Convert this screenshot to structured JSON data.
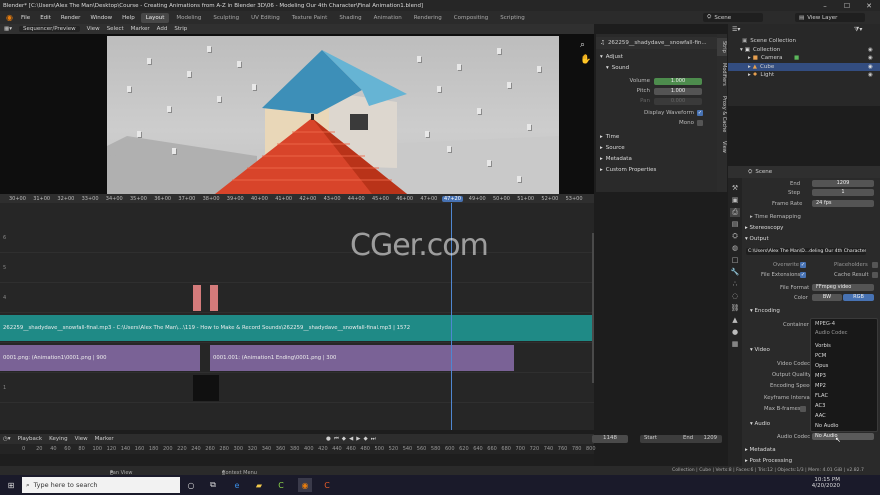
{
  "window": {
    "title": "Blender* [C:\\Users\\Alex The Man\\Desktop\\Course - Creating Animations from A-Z in Blender 3D\\06 - Modeling Our 4th Character\\Final Animation1.blend]",
    "min": "–",
    "max": "☐",
    "close": "✕"
  },
  "menu": [
    "File",
    "Edit",
    "Render",
    "Window",
    "Help"
  ],
  "workspaces": [
    "Layout",
    "Modeling",
    "Sculpting",
    "UV Editing",
    "Texture Paint",
    "Shading",
    "Animation",
    "Rendering",
    "Compositing",
    "Scripting"
  ],
  "scene_selector": "Scene",
  "view_layer": "View Layer",
  "sequencer": {
    "mode": "Sequencer/Preview",
    "menus": [
      "View",
      "Select",
      "Marker",
      "Add",
      "Strip"
    ]
  },
  "ruler": [
    "30+00",
    "31+00",
    "32+00",
    "33+00",
    "34+00",
    "35+00",
    "36+00",
    "37+00",
    "38+00",
    "39+00",
    "40+00",
    "41+00",
    "42+00",
    "43+00",
    "44+00",
    "45+00",
    "46+00",
    "47+00",
    "47+20",
    "49+00",
    "50+00",
    "51+00",
    "52+00",
    "53+00"
  ],
  "channels": [
    "6",
    "5",
    "4",
    "3",
    "2",
    "1"
  ],
  "strips": {
    "sound": "262259__shadydave__snowfall-final.mp3 - C:\\Users\\Alex The Man\\...\\119 - How to Make & Record Sounds\\262259__shadydave__snowfall-final.mp3 | 1572",
    "image1": "0001.png: (Animation1\\0001.png | 900",
    "image2": "0001.001: (Animation1 Ending\\0001.png | 300"
  },
  "watermark": "CGer.com",
  "sidebar": {
    "strip_name": "262259__shadydave__snowfall-fin...",
    "adjust": "Adjust",
    "sound": "Sound",
    "volume_label": "Volume",
    "volume": "1.000",
    "pitch_label": "Pitch",
    "pitch": "1.000",
    "pan_label": "Pan",
    "pan": "0.000",
    "display_waveform": "Display Waveform",
    "mono": "Mono",
    "sections": [
      "Time",
      "Source",
      "Metadata",
      "Custom Properties"
    ],
    "tabs": [
      "Strip",
      "Modifiers",
      "Proxy & Cache",
      "View"
    ]
  },
  "outliner": {
    "rows": [
      "Scene Collection",
      "Collection",
      "Camera",
      "Cube",
      "Light"
    ]
  },
  "properties": {
    "header": "Scene",
    "end_label": "End",
    "end": "1209",
    "step_label": "Step",
    "step": "1",
    "framerate_label": "Frame Rate",
    "framerate": "24 fps",
    "time_remapping": "Time Remapping",
    "stereoscopy": "Stereoscopy",
    "output": "Output",
    "path": "C:\\Users\\Alex The Man\\D...deling Our 4th Character\\",
    "overwrite": "Overwrite",
    "placeholders": "Placeholders",
    "file_extensions": "File Extensions",
    "cache_result": "Cache Result",
    "file_format_label": "File Format",
    "file_format": "FFmpeg video",
    "color_label": "Color",
    "color_bw": "BW",
    "color_rgb": "RGB",
    "encoding": "Encoding",
    "container_label": "Container",
    "container": "MPEG-4",
    "video": "Video",
    "video_codec_label": "Video Codec",
    "output_quality_label": "Output Quality",
    "encoding_speed_label": "Encoding Speed",
    "keyframe_interval_label": "Keyframe Interval",
    "max_bframes_label": "Max B-frames",
    "audio": "Audio",
    "audio_codec_label": "Audio Codec",
    "audio_codec": "No Audio",
    "metadata": "Metadata",
    "post_processing": "Post Processing"
  },
  "dropdown": {
    "title": "Audio Codec",
    "items": [
      "Vorbis",
      "PCM",
      "Opus",
      "MP3",
      "MP2",
      "FLAC",
      "AC3",
      "AAC",
      "No Audio"
    ]
  },
  "timeline": {
    "menus": [
      "Playback",
      "Keying",
      "View",
      "Marker"
    ],
    "current": "1148",
    "start_label": "Start",
    "start": "1",
    "end_label": "End",
    "end": "1209",
    "ticks": [
      "0",
      "20",
      "40",
      "60",
      "80",
      "100",
      "120",
      "140",
      "160",
      "180",
      "200",
      "220",
      "240",
      "260",
      "280",
      "300",
      "320",
      "340",
      "360",
      "380",
      "400",
      "420",
      "440",
      "460",
      "480",
      "500",
      "520",
      "540",
      "560",
      "580",
      "600",
      "620",
      "640",
      "660",
      "680",
      "700",
      "720",
      "740",
      "760",
      "780",
      "800",
      "820",
      "840",
      "860",
      "880",
      "900",
      "920",
      "940",
      "960",
      "980",
      "1000",
      "1020",
      "1040",
      "1060",
      "1080",
      "1100",
      "1120",
      "1140",
      "1160",
      "1180",
      "1200"
    ]
  },
  "status": {
    "left": "Pan View",
    "mid": "Context Menu",
    "right": "Collection | Cube | Verts:8 | Faces:6 | Tris:12 | Objects:1/3 | Mem: 4.01 GiB | v2.82.7"
  },
  "taskbar": {
    "search": "Type here to search",
    "time": "10:15 PM",
    "date": "4/20/2020"
  },
  "colors": {
    "accent": "#4772b3",
    "sound_strip": "#1f8a86",
    "image_strip": "#7a6296",
    "active_row": "#334d80"
  }
}
